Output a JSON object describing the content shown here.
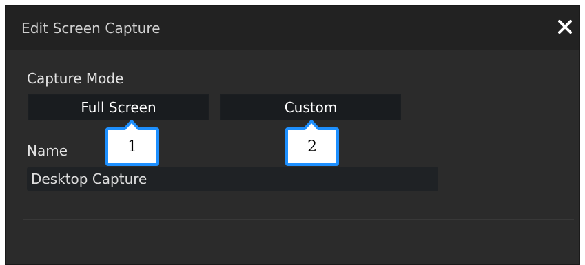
{
  "dialog": {
    "title": "Edit Screen Capture",
    "close_icon": "close-icon"
  },
  "capture_mode": {
    "label": "Capture Mode",
    "options": [
      {
        "label": "Full Screen"
      },
      {
        "label": "Custom"
      }
    ]
  },
  "name": {
    "label": "Name",
    "value": "Desktop Capture"
  },
  "callouts": [
    {
      "label": "1"
    },
    {
      "label": "2"
    }
  ],
  "colors": {
    "dialog_bg": "#2b2b2b",
    "titlebar_bg": "#222222",
    "button_bg": "#191c1f",
    "callout_border": "#1e90ff"
  }
}
